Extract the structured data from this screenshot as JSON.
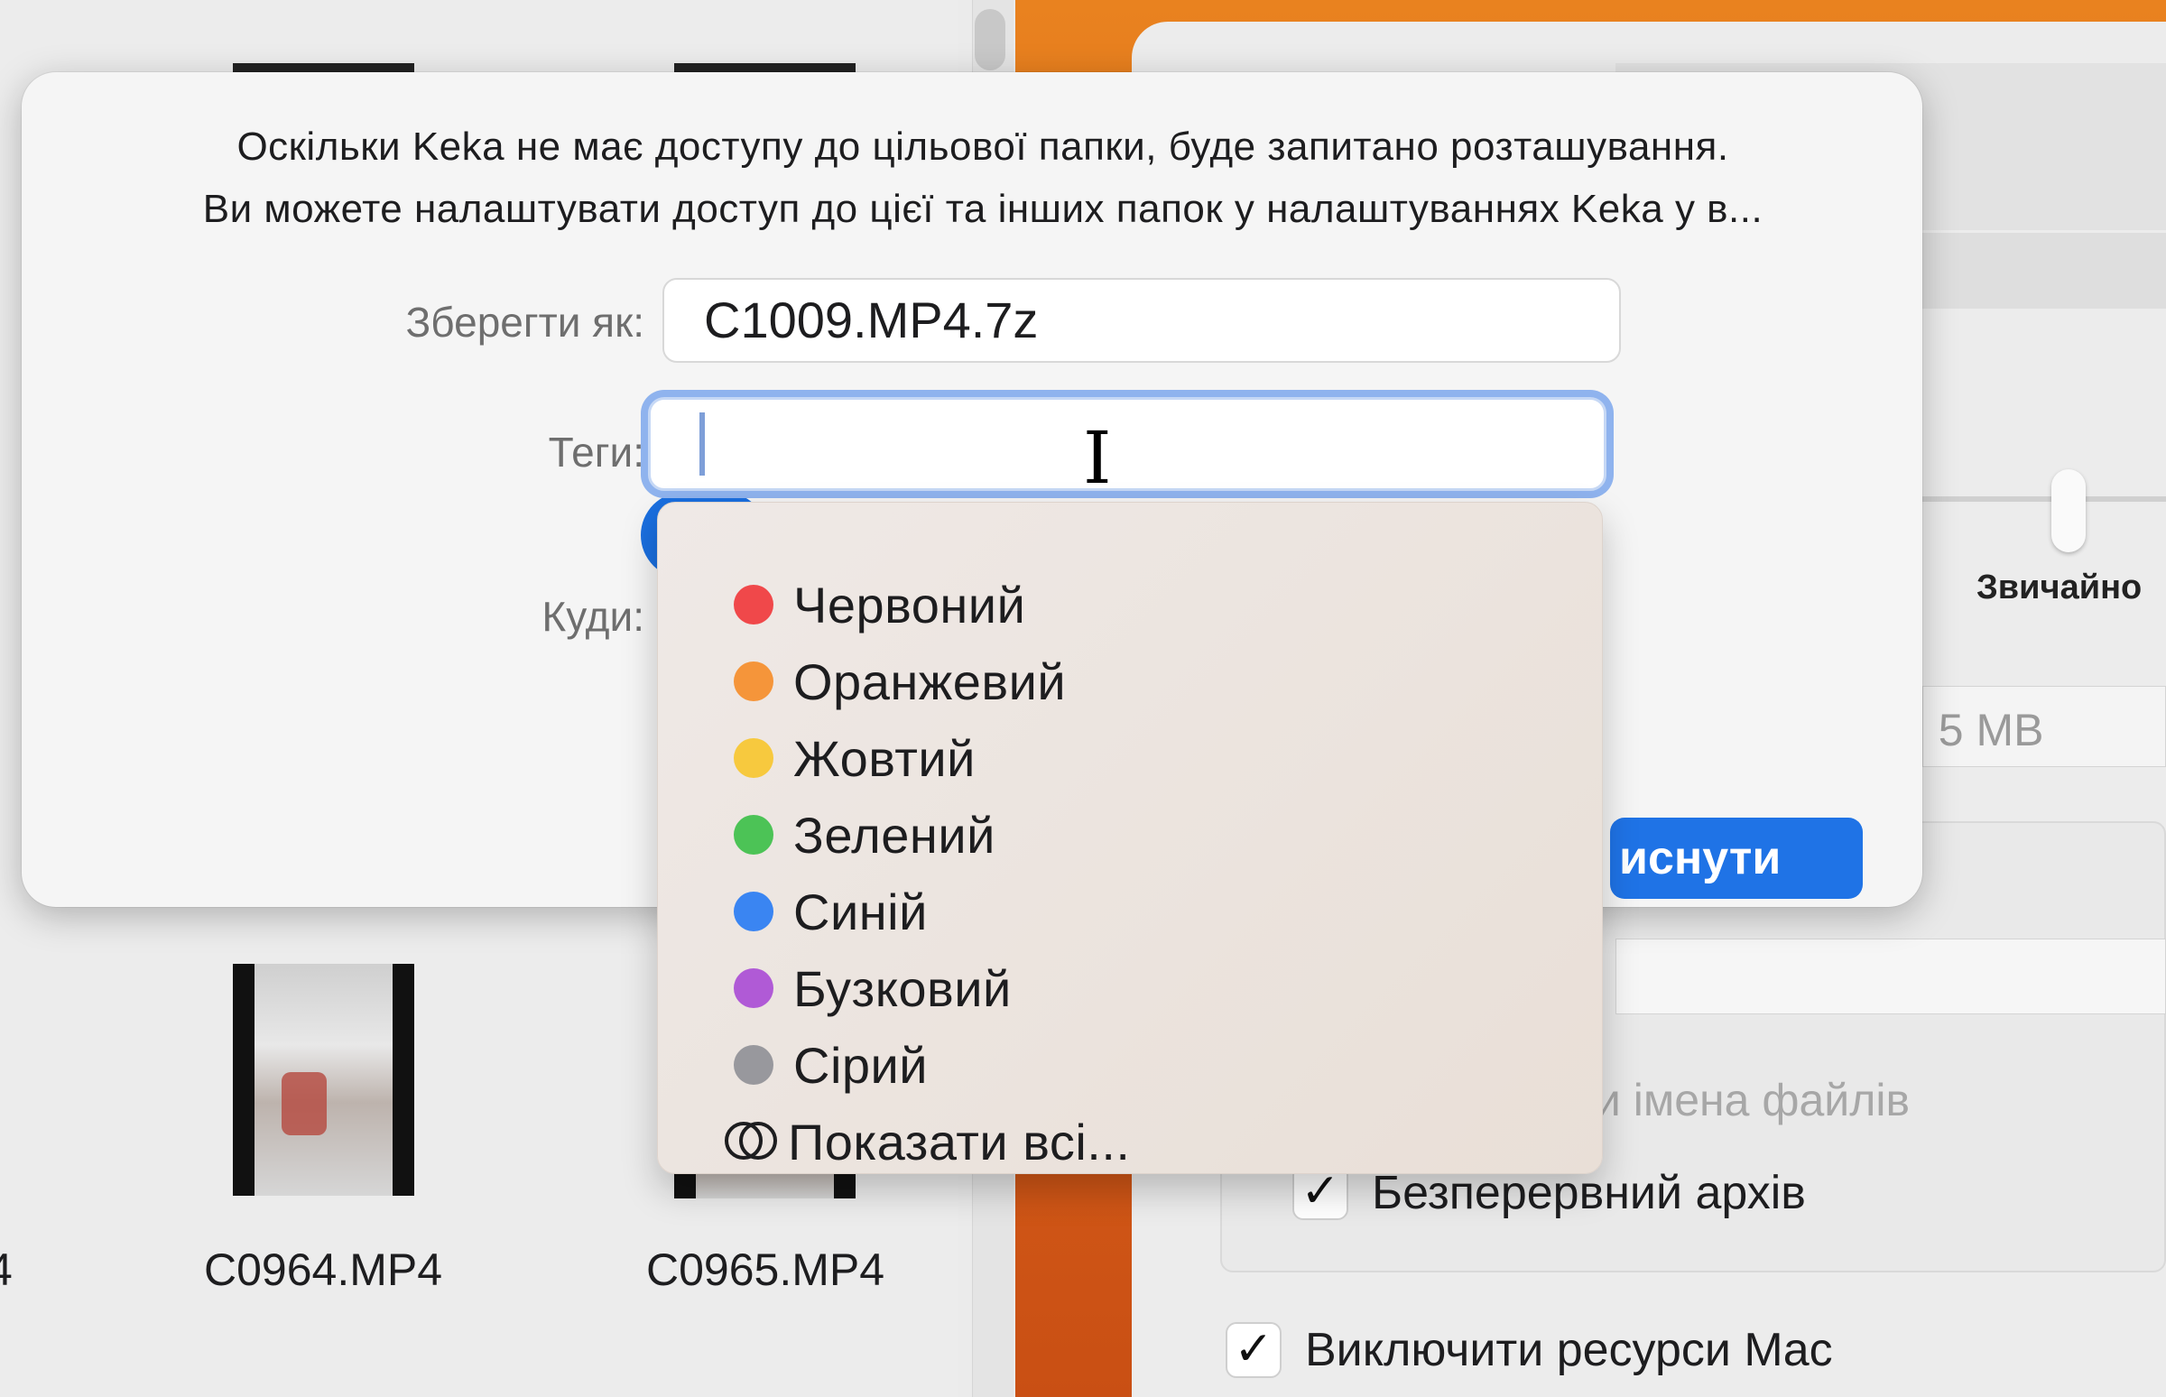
{
  "finder": {
    "files": [
      {
        "name": "C0964.MP4"
      },
      {
        "name": "C0965.MP4"
      }
    ],
    "edge_glyph": "4"
  },
  "keka": {
    "compression_level_label": "Звичайно",
    "split_field_text": ": 5 MB",
    "muted_option": "ти імена файлів",
    "options": [
      {
        "label": "Безперервний архів",
        "checked": true
      },
      {
        "label": "Виключити ресурси Mac",
        "checked": true
      }
    ]
  },
  "save_sheet": {
    "notice_line1": "Оскільки Keka не має доступу до цільової папки, буде запитано розташування.",
    "notice_line2": "Ви можете налаштувати доступ до цієї та інших папок у налаштуваннях Keka у в...",
    "save_as_label": "Зберегти як:",
    "save_as_value": "C1009.MP4.7z",
    "tags_label": "Теги:",
    "tags_value": "",
    "where_label": "Куди:",
    "primary_button_label": "иснути"
  },
  "tags_menu": {
    "items": [
      {
        "label": "Червоний",
        "color": "#f0484a"
      },
      {
        "label": "Оранжевий",
        "color": "#f5953a"
      },
      {
        "label": "Жовтий",
        "color": "#f7c93e"
      },
      {
        "label": "Зелений",
        "color": "#4cc356"
      },
      {
        "label": "Синій",
        "color": "#3a85f2"
      },
      {
        "label": "Бузковий",
        "color": "#b05ad6"
      },
      {
        "label": "Сірий",
        "color": "#98989d"
      }
    ],
    "show_all_label": "Показати всі..."
  },
  "icons": {
    "text_cursor": "ibeam-cursor-icon",
    "show_all": "overlapping-circles-icon",
    "checkmark": "checkmark-icon"
  }
}
